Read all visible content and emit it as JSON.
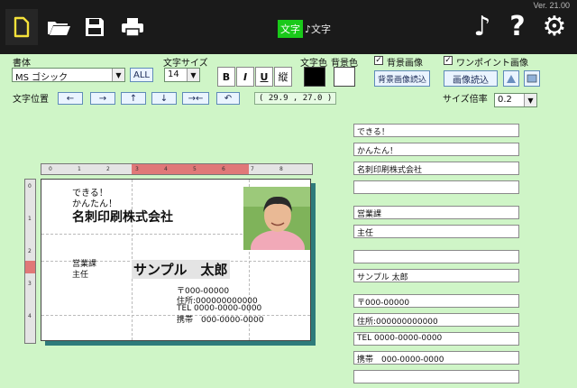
{
  "app": {
    "version": "Ver. 21.00"
  },
  "toolbar": {
    "icons": [
      "new-document-icon",
      "open-folder-icon",
      "save-icon",
      "print-icon",
      "music-note-icon",
      "help-icon",
      "gear-icon"
    ],
    "music_glyph": "♪",
    "help_glyph": "?",
    "gear_glyph": "⚙",
    "mode_tabs": [
      "文字",
      "♪文字"
    ]
  },
  "controls": {
    "font_label": "書体",
    "font_value": "MS ゴシック",
    "all_button": "ALL",
    "size_label": "文字サイズ",
    "size_value": "14",
    "bold": "B",
    "italic": "I",
    "underline": "U",
    "vertical": "縦",
    "text_color_label": "文字色",
    "bg_color_label": "背景色",
    "text_color": "#000000",
    "bg_color": "#ffffff",
    "bg_image_label": "背景画像",
    "bg_image_button": "背景画像読込",
    "onepoint_label": "ワンポイント画像",
    "image_load_button": "画像読込",
    "size_ratio_label": "サイズ倍率",
    "size_ratio_value": "0.2",
    "position_label": "文字位置",
    "arrows": [
      "←",
      "→",
      "↑",
      "↓",
      "→←",
      "↶"
    ],
    "coords": "( 29.9 , 27.0 )"
  },
  "ruler": {
    "h_numbers": [
      "0",
      "1",
      "2",
      "3",
      "4",
      "5",
      "6",
      "7",
      "8"
    ],
    "v_numbers": [
      "0",
      "1",
      "2",
      "3",
      "4"
    ]
  },
  "card": {
    "line1": "できる！",
    "line2": "かんたん！",
    "company": "名刺印刷株式会社",
    "dept": "営業課",
    "title": "主任",
    "name": "サンプル　太郎",
    "postal": "〒000-00000",
    "address": "住所:000000000000",
    "tel": "TEL 0000-0000-0000",
    "mobile": "携帯　000-0000-0000"
  },
  "fields": [
    "できる！",
    "かんたん！",
    "名刺印刷株式会社",
    "",
    "営業課",
    "主任",
    "",
    "サンプル 太郎",
    "〒000-00000",
    "住所:000000000000",
    "TEL 0000-0000-0000",
    "携帯　000-0000-0000",
    ""
  ]
}
